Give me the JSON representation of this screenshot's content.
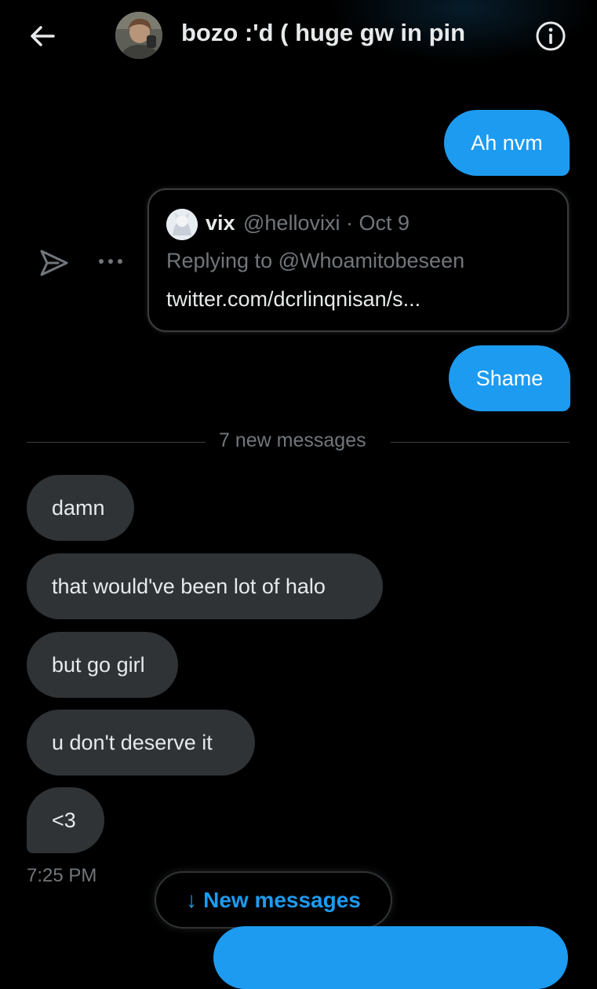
{
  "header": {
    "title": "bozo :'d ( huge gw in pin",
    "back_icon": "arrow-left-icon",
    "info_icon": "info-icon"
  },
  "messages_sent": [
    {
      "text": "Ah nvm"
    },
    {
      "text": "Shame"
    }
  ],
  "quoted_tweet": {
    "name": "vix",
    "meta": "@hellovixi · Oct 9",
    "replying_to": "Replying to @Whoamitobeseen",
    "link": "twitter.com/dcrlinqnisan/s..."
  },
  "divider": {
    "label": "7 new messages"
  },
  "messages_received": [
    {
      "text": "damn"
    },
    {
      "text": "that would've been lot of halo"
    },
    {
      "text": "but go girl"
    },
    {
      "text": "u don't deserve it"
    },
    {
      "text": "<3"
    }
  ],
  "timestamp": "7:25 PM",
  "new_messages_button": {
    "arrow": "↓",
    "label": "New messages"
  },
  "colors": {
    "accent": "#1d9bf0",
    "incoming_bubble": "#2f3336",
    "muted_text": "#71767b",
    "background": "#000000"
  }
}
